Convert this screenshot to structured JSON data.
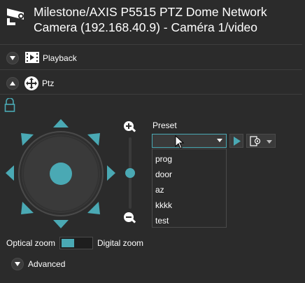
{
  "header": {
    "title": "Milestone/AXIS P5515 PTZ Dome Network Camera (192.168.40.9) - Caméra 1/video",
    "icon": "security-camera-icon"
  },
  "sections": {
    "playback": {
      "label": "Playback",
      "icon": "film-strip-icon",
      "expanded": false
    },
    "ptz": {
      "label": "Ptz",
      "icon": "move-arrows-icon",
      "expanded": true
    },
    "advanced": {
      "label": "Advanced",
      "expanded": false
    }
  },
  "ptz": {
    "lock_icon": "lock-icon",
    "zoom_in_icon": "zoom-in-icon",
    "zoom_out_icon": "zoom-out-icon",
    "zoom_level": 0.5,
    "preset": {
      "label": "Preset",
      "value": "",
      "options": [
        "prog",
        "door",
        "az",
        "kkkk",
        "test"
      ]
    },
    "optical_zoom_label": "Optical zoom",
    "digital_zoom_label": "Digital zoom",
    "zoom_mode": "optical"
  },
  "colors": {
    "accent": "#4aa9b4",
    "background": "#2b2b2b",
    "text": "#ffffff"
  }
}
